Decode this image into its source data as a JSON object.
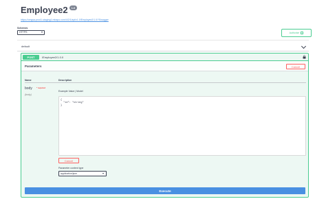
{
  "header": {
    "title": "Employee2",
    "version": "1.0",
    "url": "https://omgsa-prod1-staging1.mbapo.com/4/2/1/api/v1.0/Employee2/1.0/?Swagger"
  },
  "schemes": {
    "label": "Schemes",
    "selected": "HTTPS"
  },
  "authorize": {
    "label": "Authorize"
  },
  "tag": {
    "name": "default"
  },
  "operation": {
    "method": "POST",
    "path": "/Employee2/1.0.0",
    "method_color": "#49cc90",
    "parameters_title": "Parameters",
    "cancel_label": "Cancel",
    "columns": {
      "name": "Name",
      "description": "Description"
    },
    "param": {
      "name": "body",
      "required": "* required",
      "location": "(body)",
      "model_links": "Example Value | Model",
      "body_value": "{\n  \"id\": \"string\"\n}"
    },
    "cancel_body_label": "Cancel",
    "content_type_label": "Parameter content type",
    "content_type_selected": "application/json",
    "execute_label": "Execute"
  },
  "colors": {
    "post": "#49cc90",
    "cancel": "#ff6060",
    "execute": "#4990e2"
  }
}
